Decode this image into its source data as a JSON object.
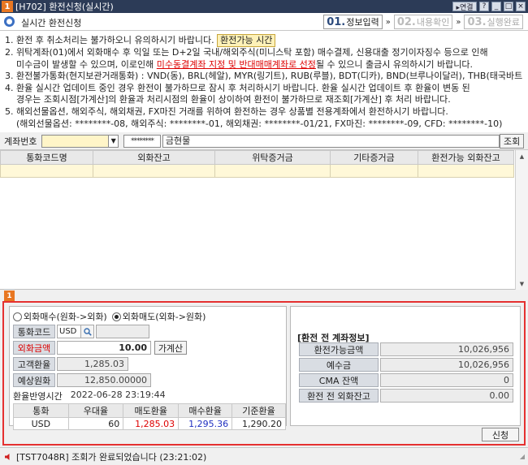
{
  "window": {
    "number": "1",
    "title": "[H702] 환전신청(실시간)",
    "btn_link": "▸연결",
    "btn_help": "?",
    "btn_min": "_",
    "btn_max": "□",
    "btn_close": "×"
  },
  "header": {
    "title": "실시간 환전신청",
    "steps": [
      {
        "num": "01.",
        "label": "정보입력"
      },
      {
        "num": "02.",
        "label": "내용확인"
      },
      {
        "num": "03.",
        "label": "실행완료"
      }
    ]
  },
  "notes": {
    "n1a": "1. 환전 후 취소처리는 불가하오니 유의하시기 바랍니다.",
    "n1_btn": "환전가능 시간",
    "n2a": "2. 위탁계좌(01)에서 외화매수 후 익일 또는 D+2일 국내/해외주식(미니스탁 포함) 매수결제, 신용대출 정기이자징수 등으로 인해",
    "n2b_pre": "미수금이 발생할 수 있으며, 이로인해 ",
    "n2b_red": "미수동결계좌 지정 및 반대매매계좌로 선정",
    "n2b_post": "될 수 있으니 출금시 유의하시기 바랍니다.",
    "n3": "3. 환전불가통화(현지보관거래통화) : VND(동), BRL(헤알), MYR(링기트), RUB(루블), BDT(디카), BND(브루나이달러), THB(태국바트)",
    "n4a": "4. 환율 실시간 업데이트 중인 경우 환전이 불가하므로 잠시 후 처리하시기 바랍니다. 환율 실시간 업데이트 후 환율이 변동 된",
    "n4b": "경우는 조회시점[가계산]의 환율과 처리시점의 환율이 상이하여 환전이 불가하므로 재조회[가계산] 후 처리 바랍니다.",
    "n5a": "5. 해외선물옵션, 해외주식, 해외채권, FX마진 거래를 위하여 환전하는 경우 상품별 전용계좌에서 환전하시기 바랍니다.",
    "n5b": "(해외선물옵션: ********-08, 해외주식: ********-01, 해외채권: ********-01/21, FX마진: ********-09, CFD: ********-10)"
  },
  "account": {
    "label": "계좌번호",
    "number": "",
    "password_mask": "********",
    "holder": "금현물",
    "query_btn": "조회"
  },
  "grid": {
    "headers": [
      "통화코드명",
      "외화잔고",
      "위탁증거금",
      "기타증거금",
      "환전가능 외화잔고"
    ]
  },
  "panel": {
    "badge": "1",
    "radio_buy": "외화매수(원화->외화)",
    "radio_sell": "외화매도(외화->원화)",
    "currency_code_label": "통화코드",
    "currency_code": "USD",
    "foreign_amount_label": "외화금액",
    "foreign_amount": "10.00",
    "calc_btn": "가계산",
    "customer_rate_label": "고객환율",
    "customer_rate": "1,285.03",
    "expected_krw_label": "예상원화",
    "expected_krw": "12,850.00000",
    "rate_time_label": "환율반영시간",
    "rate_time": "2022-06-28 23:19:44",
    "rate_table": {
      "headers": [
        "통화",
        "우대율",
        "매도환율",
        "매수환율",
        "기준환율"
      ],
      "row": [
        "USD",
        "60",
        "1,285.03",
        "1,295.36",
        "1,290.20"
      ]
    },
    "info_title": "[환전 전 계좌정보]",
    "info": [
      {
        "label": "환전가능금액",
        "value": "10,026,956"
      },
      {
        "label": "예수금",
        "value": "10,026,956"
      },
      {
        "label": "CMA 잔액",
        "value": "0"
      },
      {
        "label": "환전 전 외화잔고",
        "value": "0.00"
      }
    ],
    "apply_btn": "신청"
  },
  "status": {
    "message": "[TST7048R] 조회가 완료되었습니다 (23:21:02)"
  }
}
